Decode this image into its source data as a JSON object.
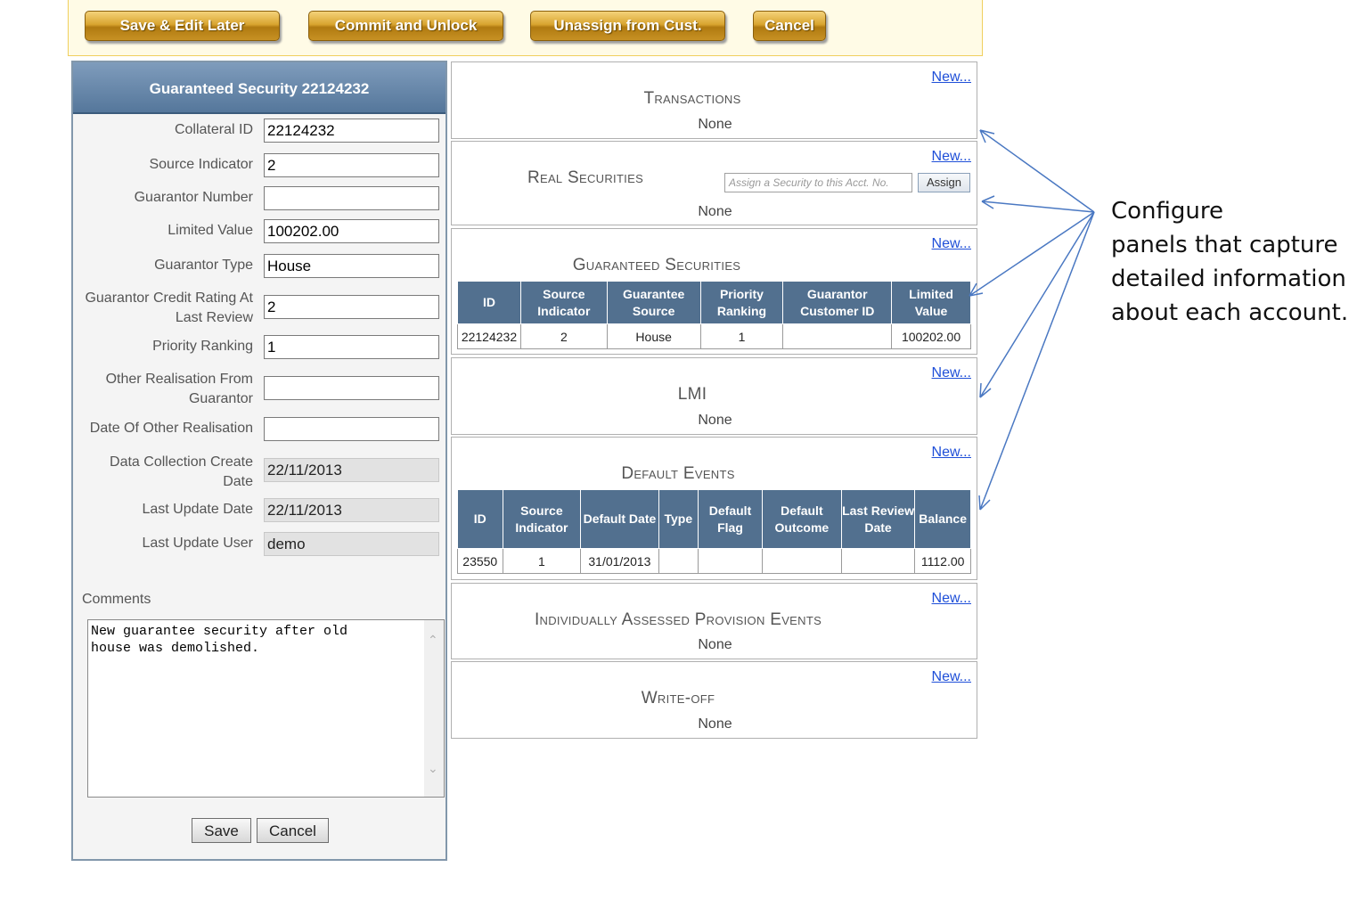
{
  "toolbar": {
    "save_edit_later": "Save & Edit Later",
    "commit_unlock": "Commit and Unlock",
    "unassign": "Unassign from Cust.",
    "cancel": "Cancel"
  },
  "form": {
    "title": "Guaranteed Security 22124232",
    "fields": [
      {
        "label": "Collateral ID",
        "value": "22124232"
      },
      {
        "label": "Source Indicator",
        "value": "2"
      },
      {
        "label": "Guarantor Number",
        "value": ""
      },
      {
        "label": "Limited Value",
        "value": "100202.00"
      },
      {
        "label": "Guarantor Type",
        "value": "House"
      },
      {
        "label": "Guarantor Credit Rating At Last Review",
        "value": "2"
      },
      {
        "label": "Priority Ranking",
        "value": "1"
      },
      {
        "label": "Other Realisation From Guarantor",
        "value": ""
      },
      {
        "label": "Date Of Other Realisation",
        "value": ""
      },
      {
        "label": "Data Collection Create Date",
        "value": "22/11/2013"
      },
      {
        "label": "Last Update Date",
        "value": "22/11/2013"
      },
      {
        "label": "Last Update User",
        "value": "demo"
      }
    ],
    "comments_label": "Comments",
    "comments_value": "New guarantee security after old\nhouse was demolished.",
    "save_label": "Save",
    "cancel_label": "Cancel"
  },
  "panels": {
    "new_label": "New...",
    "none_label": "None",
    "transactions": {
      "title": "Transactions"
    },
    "real_securities": {
      "title": "Real Securities",
      "assign_placeholder": "Assign a Security to this Acct. No.",
      "assign_label": "Assign"
    },
    "guaranteed_securities": {
      "title": "Guaranteed Securities",
      "headers": [
        "ID",
        "Source Indicator",
        "Guarantee Source",
        "Priority Ranking",
        "Guarantor Customer ID",
        "Limited Value"
      ],
      "row": [
        "22124232",
        "2",
        "House",
        "1",
        "",
        "100202.00"
      ]
    },
    "lmi": {
      "title": "LMI"
    },
    "default_events": {
      "title": "Default Events",
      "headers": [
        "ID",
        "Source Indicator",
        "Default Date",
        "Type",
        "Default Flag",
        "Default Outcome",
        "Last Review Date",
        "Balance"
      ],
      "row": [
        "23550",
        "1",
        "31/01/2013",
        "",
        "",
        "",
        "",
        "1112.00"
      ]
    },
    "iap_events": {
      "title": "Individually Assessed Provision Events"
    },
    "write_off": {
      "title": "Write-off"
    }
  },
  "annotation": {
    "line1": "Configure",
    "line2": "panels that capture",
    "line3": "detailed information",
    "line4": "about each account."
  },
  "colors": {
    "accent_gold": "#d9a530",
    "header_blue": "#52708f",
    "link_blue": "#1f4fd8",
    "arrow_blue": "#4a78c2"
  }
}
